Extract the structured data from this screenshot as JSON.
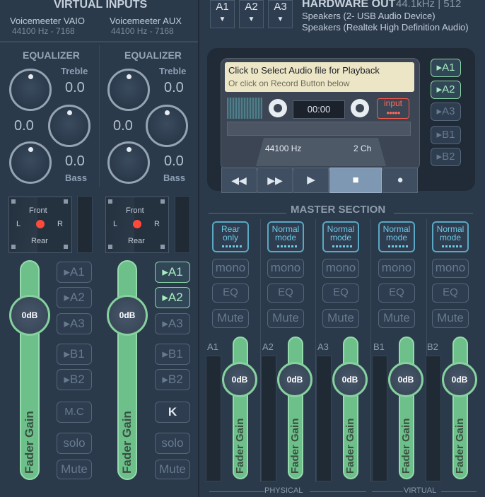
{
  "virtual_inputs": {
    "title": "VIRTUAL INPUTS",
    "strips": [
      {
        "name": "Voicemeeter VAIO",
        "rate": "44100 Hz - 7168",
        "eq_label": "EQUALIZER",
        "treble_label": "Treble",
        "treble": "0.0",
        "mid": "0.0",
        "bass": "0.0",
        "bass_label": "Bass",
        "pan_front": "Front",
        "pan_rear": "Rear",
        "pan_l": "L",
        "pan_r": "R",
        "fader": "0dB",
        "fader_label": "Fader Gain",
        "buses": [
          "A1",
          "A2",
          "A3",
          "B1",
          "B2"
        ],
        "bus_on": [
          false,
          false,
          false,
          false,
          false
        ],
        "mc": "M.C",
        "solo": "solo",
        "mute": "Mute"
      },
      {
        "name": "Voicemeeter AUX",
        "rate": "44100 Hz - 7168",
        "eq_label": "EQUALIZER",
        "treble_label": "Treble",
        "treble": "0.0",
        "mid": "0.0",
        "bass": "0.0",
        "bass_label": "Bass",
        "pan_front": "Front",
        "pan_rear": "Rear",
        "pan_l": "L",
        "pan_r": "R",
        "fader": "0dB",
        "fader_label": "Fader Gain",
        "buses": [
          "A1",
          "A2",
          "A3",
          "B1",
          "B2"
        ],
        "bus_on": [
          true,
          true,
          false,
          false,
          false
        ],
        "mc": "K",
        "solo": "solo",
        "mute": "Mute"
      }
    ]
  },
  "hardware_out": {
    "title": "HARDWARE OUT",
    "rate": "44.1kHz | 512",
    "buttons": [
      "A1",
      "A2",
      "A3"
    ],
    "devices": [
      "Speakers (2- USB Audio Device)",
      "Speakers (Realtek High Definition Audio)"
    ]
  },
  "player": {
    "line1": "Click to Select Audio file for Playback",
    "line2": "Or click on Record Button below",
    "time": "00:00",
    "input": "input",
    "rate": "44100 Hz",
    "channels": "2 Ch",
    "side_buttons": [
      "A1",
      "A2",
      "A3",
      "B1",
      "B2"
    ],
    "side_on": [
      true,
      true,
      false,
      false,
      false
    ],
    "transport": [
      "rewind",
      "fast-forward",
      "play",
      "stop",
      "record"
    ]
  },
  "master": {
    "title": "MASTER SECTION",
    "physical_label": "PHYSICAL",
    "virtual_label": "VIRTUAL",
    "buses": [
      {
        "name": "A1",
        "mode_line1": "Rear",
        "mode_line2": "only",
        "mono": "mono",
        "eq": "EQ",
        "mute": "Mute",
        "fader": "0dB",
        "fader_label": "Fader Gain"
      },
      {
        "name": "A2",
        "mode_line1": "Normal",
        "mode_line2": "mode",
        "mono": "mono",
        "eq": "EQ",
        "mute": "Mute",
        "fader": "0dB",
        "fader_label": "Fader Gain"
      },
      {
        "name": "A3",
        "mode_line1": "Normal",
        "mode_line2": "mode",
        "mono": "mono",
        "eq": "EQ",
        "mute": "Mute",
        "fader": "0dB",
        "fader_label": "Fader Gain"
      },
      {
        "name": "B1",
        "mode_line1": "Normal",
        "mode_line2": "mode",
        "mono": "mono",
        "eq": "EQ",
        "mute": "Mute",
        "fader": "0dB",
        "fader_label": "Fader Gain"
      },
      {
        "name": "B2",
        "mode_line1": "Normal",
        "mode_line2": "mode",
        "mono": "mono",
        "eq": "EQ",
        "mute": "Mute",
        "fader": "0dB",
        "fader_label": "Fader Gain"
      }
    ]
  },
  "colors": {
    "accent_green": "#6dc08a",
    "accent_blue": "#6ec9e6",
    "record_red": "#ff5a4a"
  }
}
